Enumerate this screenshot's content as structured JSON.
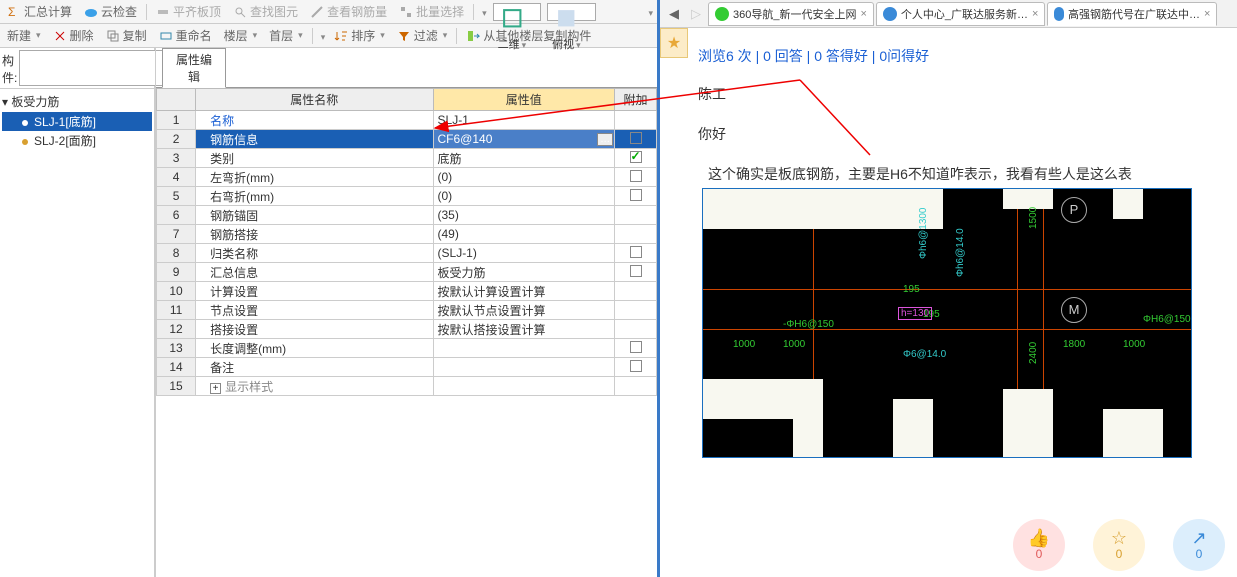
{
  "toolbar1": {
    "sumcalc": "汇总计算",
    "cloudcheck": "云检查",
    "flatplate": "平齐板顶",
    "findelem": "查找图元",
    "checkrebar": "查看钢筋量",
    "batchsel": "批量选择",
    "view2d": "二维",
    "frontview": "俯视"
  },
  "toolbar2": {
    "new": "新建",
    "del": "删除",
    "copy": "复制",
    "rename": "重命名",
    "floor": "楼层",
    "firstfloor": "首层",
    "sort": "排序",
    "filter": "过滤",
    "copyfrom": "从其他楼层复制构件"
  },
  "sidebar": {
    "search_label": "构件:",
    "root": "板受力筋",
    "items": [
      {
        "label": "SLJ-1[底筋]",
        "selected": true
      },
      {
        "label": "SLJ-2[面筋]",
        "selected": false
      }
    ]
  },
  "prop": {
    "tab": "属性编辑",
    "headers": {
      "name": "属性名称",
      "value": "属性值",
      "extra": "附加"
    },
    "rows": [
      {
        "n": "1",
        "name": "名称",
        "val": "SLJ-1",
        "link": true,
        "chk": ""
      },
      {
        "n": "2",
        "name": "钢筋信息",
        "val": "CF6@140",
        "selected": true,
        "dots": true,
        "chk": "off"
      },
      {
        "n": "3",
        "name": "类别",
        "val": "底筋",
        "chk": "on"
      },
      {
        "n": "4",
        "name": "左弯折(mm)",
        "val": "(0)",
        "chk": "off"
      },
      {
        "n": "5",
        "name": "右弯折(mm)",
        "val": "(0)",
        "chk": "off"
      },
      {
        "n": "6",
        "name": "钢筋锚固",
        "val": "(35)",
        "chk": ""
      },
      {
        "n": "7",
        "name": "钢筋搭接",
        "val": "(49)",
        "chk": ""
      },
      {
        "n": "8",
        "name": "归类名称",
        "val": "(SLJ-1)",
        "chk": "off"
      },
      {
        "n": "9",
        "name": "汇总信息",
        "val": "板受力筋",
        "chk": "off"
      },
      {
        "n": "10",
        "name": "计算设置",
        "val": "按默认计算设置计算",
        "chk": ""
      },
      {
        "n": "11",
        "name": "节点设置",
        "val": "按默认节点设置计算",
        "chk": ""
      },
      {
        "n": "12",
        "name": "搭接设置",
        "val": "按默认搭接设置计算",
        "chk": ""
      },
      {
        "n": "13",
        "name": "长度调整(mm)",
        "val": "",
        "chk": "off"
      },
      {
        "n": "14",
        "name": "备注",
        "val": "",
        "chk": "off"
      },
      {
        "n": "15",
        "name": "显示样式",
        "val": "",
        "expand": true,
        "gray": true
      }
    ]
  },
  "browser": {
    "tabs": [
      {
        "label": "360导航_新一代安全上网",
        "color": "#3c3"
      },
      {
        "label": "个人中心_广联达服务新…",
        "color": "#3a8ad8"
      },
      {
        "label": "高强钢筋代号在广联达中…",
        "color": "#3a8ad8",
        "active": true
      }
    ]
  },
  "page": {
    "stats_prefix": "浏览",
    "views": "6",
    "stats_views_suffix": " 次",
    "answers": "0 回答",
    "goodans": "0 答得好",
    "goodq": "0问得好",
    "author": "陈工",
    "hello": "你好",
    "body": "这个确实是板底钢筋，主要是H6不知道咋表示，我看有些人是这么表"
  },
  "cad": {
    "labels": {
      "h130": "h=130",
      "n195a": "195",
      "n195b": "195",
      "h6_150a": "-ΦH6@150",
      "h6_150b": "ΦH6@150",
      "h6_14a": "Φh6@14.0",
      "h6_14b": "Φ6@14.0",
      "phi6_1300": "Φh6@1300",
      "d1000a": "1000",
      "d1000b": "1000",
      "d1800": "1800",
      "d1000c": "1000",
      "d1500": "1500",
      "d2400": "2400",
      "p": "P",
      "m": "M"
    }
  },
  "reactions": {
    "like": "0",
    "fav": "0",
    "share": "0"
  }
}
